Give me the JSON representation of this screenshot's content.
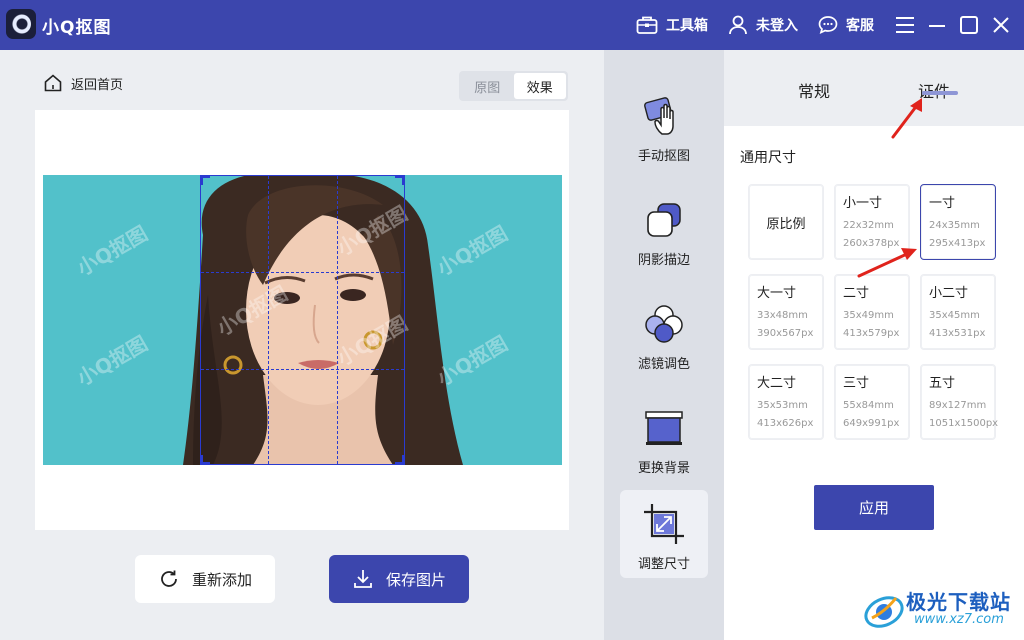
{
  "app": {
    "title": "小Q抠图"
  },
  "toolbar": {
    "toolbox": "工具箱",
    "login": "未登入",
    "service": "客服"
  },
  "left": {
    "home": "返回首页",
    "view_toggle": {
      "original": "原图",
      "effect": "效果",
      "selected": "效果"
    },
    "watermark_text": "小Q抠图",
    "buttons": {
      "readd": "重新添加",
      "save": "保存图片"
    }
  },
  "tools": [
    {
      "label": "手动抠图",
      "icon": "hand-cutout-icon"
    },
    {
      "label": "阴影描边",
      "icon": "shadow-outline-icon"
    },
    {
      "label": "滤镜调色",
      "icon": "filter-color-icon"
    },
    {
      "label": "更换背景",
      "icon": "change-background-icon"
    },
    {
      "label": "调整尺寸",
      "icon": "resize-icon",
      "active": true
    }
  ],
  "right": {
    "tabs": [
      {
        "label": "常规"
      },
      {
        "label": "证件",
        "active": true
      }
    ],
    "section_title": "通用尺寸",
    "sizes": [
      {
        "name": "原比例",
        "mm": "",
        "px": ""
      },
      {
        "name": "小一寸",
        "mm": "22x32mm",
        "px": "260x378px"
      },
      {
        "name": "一寸",
        "mm": "24x35mm",
        "px": "295x413px",
        "selected": true
      },
      {
        "name": "大一寸",
        "mm": "33x48mm",
        "px": "390x567px"
      },
      {
        "name": "二寸",
        "mm": "35x49mm",
        "px": "413x579px"
      },
      {
        "name": "小二寸",
        "mm": "35x45mm",
        "px": "413x531px"
      },
      {
        "name": "大二寸",
        "mm": "35x53mm",
        "px": "413x626px"
      },
      {
        "name": "三寸",
        "mm": "55x84mm",
        "px": "649x991px"
      },
      {
        "name": "五寸",
        "mm": "89x127mm",
        "px": "1051x1500px"
      }
    ],
    "apply": "应用"
  },
  "site_watermark": {
    "name": "极光下载站",
    "url": "www.xz7.com"
  },
  "colors": {
    "brand": "#3c46ad",
    "photo_bg": "#52c1ca",
    "crop_line": "#2a3bd0",
    "arrow": "#e0231c"
  }
}
